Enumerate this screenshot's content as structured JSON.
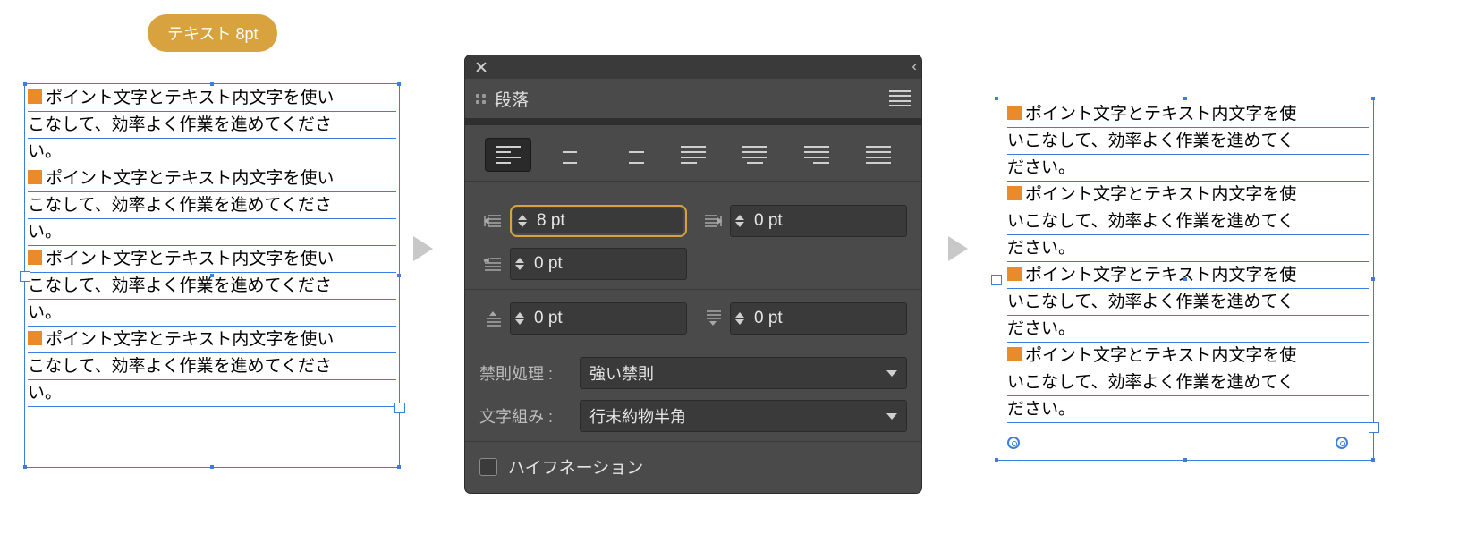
{
  "badge": {
    "label": "テキスト 8pt"
  },
  "text_frame": {
    "paragraph": "ポイント文字とテキスト内文字を使いこなして、効率よく作業を進めてください。",
    "before_lines": [
      [
        "■ポイント文字とテキスト内文字を使い",
        "こなして、効率よく作業を進めてくださ",
        "い。"
      ],
      [
        "■ポイント文字とテキスト内文字を使い",
        "こなして、効率よく作業を進めてくださ",
        "い。"
      ],
      [
        "■ポイント文字とテキスト内文字を使い",
        "こなして、効率よく作業を進めてくださ",
        "い。"
      ],
      [
        "■ポイント文字とテキスト内文字を使い",
        "こなして、効率よく作業を進めてくださ",
        "い。"
      ]
    ],
    "after_lines": [
      [
        "■ポイント文字とテキスト内文字を使",
        "いこなして、効率よく作業を進めてく",
        "ださい。"
      ],
      [
        "■ポイント文字とテキスト内文字を使",
        "いこなして、効率よく作業を進めてく",
        "ださい。"
      ],
      [
        "■ポイント文字とテキスト内文字を使",
        "いこなして、効率よく作業を進めてく",
        "ださい。"
      ],
      [
        "■ポイント文字とテキスト内文字を使",
        "いこなして、効率よく作業を進めてく",
        "ださい。"
      ]
    ]
  },
  "panel": {
    "title": "段落",
    "alignment_selected_index": 0,
    "alignments": [
      "align-left",
      "align-center",
      "align-right",
      "justify-last-left",
      "justify-last-center",
      "justify-last-right",
      "justify-full"
    ],
    "left_indent": "8 pt",
    "right_indent": "0 pt",
    "first_line_indent": "0 pt",
    "space_before": "0 pt",
    "space_after": "0 pt",
    "kinsoku_label": "禁則処理 :",
    "kinsoku_value": "強い禁則",
    "mojikumi_label": "文字組み :",
    "mojikumi_value": "行末約物半角",
    "hyphenation_label": "ハイフネーション",
    "hyphenation_checked": false
  }
}
